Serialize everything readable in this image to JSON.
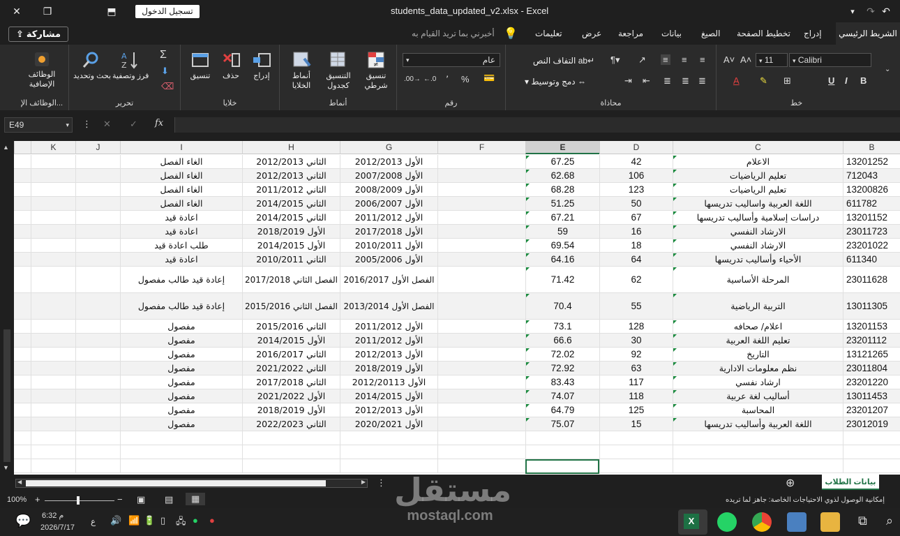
{
  "window": {
    "title": "students_data_updated_v2.xlsx  -  Excel",
    "signin_label": "تسجيل الدخول"
  },
  "tabs": {
    "share": "مشاركة",
    "tell_me": "أخبرني بما تريد القيام به",
    "items": [
      "الشريط الرئيسي",
      "إدراج",
      "تخطيط الصفحة",
      "الصيغ",
      "بيانات",
      "مراجعة",
      "عرض",
      "تعليمات"
    ]
  },
  "ribbon": {
    "addins": {
      "label": "الوظائف الإضافية",
      "group": "الوظائف الإ..."
    },
    "editing": {
      "find": "بحث وتحديد",
      "sort": "فرز وتصفية",
      "group": "تحرير"
    },
    "cells": {
      "format": "تنسيق",
      "delete": "حذف",
      "insert": "إدراج",
      "group": "خلايا"
    },
    "styles": {
      "cell_styles": "أنماط الخلايا",
      "format_table": "التنسيق كجدول",
      "conditional": "تنسيق شرطي",
      "group": "أنماط"
    },
    "number": {
      "format_value": "عام",
      "percent": "%",
      "comma": "٬",
      "group": "رقم"
    },
    "alignment": {
      "wrap": "التفاف النص",
      "merge": "دمج وتوسيط",
      "group": "محاذاة"
    },
    "font": {
      "name": "Calibri",
      "size": "11",
      "group": "خط"
    }
  },
  "formula_bar": {
    "name_box": "E49",
    "fx": "fx",
    "value": ""
  },
  "columns": [
    {
      "name": "K"
    },
    {
      "name": "J"
    },
    {
      "name": "I"
    },
    {
      "name": "H"
    },
    {
      "name": "G"
    },
    {
      "name": "F"
    },
    {
      "name": "E",
      "selected": true
    },
    {
      "name": "D"
    },
    {
      "name": "C"
    },
    {
      "name": "B"
    }
  ],
  "rows": [
    {
      "B": "13201252",
      "C": "الاعلام",
      "D": "42",
      "E": "67.25",
      "G": "الأول 2012/2013",
      "H": "الثاني 2012/2013",
      "I": "الغاء الفصل"
    },
    {
      "B": "712043",
      "C": "تعليم الرياضيات",
      "D": "106",
      "E": "62.68",
      "G": "الأول 2007/2008",
      "H": "الثاني 2012/2013",
      "I": "الغاء الفصل"
    },
    {
      "B": "13200826",
      "C": "تعليم الرياضيات",
      "D": "123",
      "E": "68.28",
      "G": "الأول 2008/2009",
      "H": "الثاني 2011/2012",
      "I": "الغاء الفصل"
    },
    {
      "B": "611782",
      "C": "اللغة العربية واساليب تدريسها",
      "D": "50",
      "E": "51.25",
      "G": "الأول 2006/2007",
      "H": "الثاني 2014/2015",
      "I": "الغاء الفصل"
    },
    {
      "B": "13201152",
      "C": "دراسات إسلامية وأساليب تدريسها",
      "D": "67",
      "E": "67.21",
      "G": "الأول 2011/2012",
      "H": "الثاني 2014/2015",
      "I": "اعادة قيد"
    },
    {
      "B": "23011723",
      "C": "الارشاد النفسي",
      "D": "16",
      "E": "59",
      "G": "الأول 2017/2018",
      "H": "الأول 2018/2019",
      "I": "اعادة قيد"
    },
    {
      "B": "23201022",
      "C": "الارشاد النفسي",
      "D": "18",
      "E": "69.54",
      "G": "الأول 2010/2011",
      "H": "الأول 2014/2015",
      "I": "طلب اعادة قيد"
    },
    {
      "B": "611340",
      "C": "الأحياء وأساليب تدريسها",
      "D": "64",
      "E": "64.16",
      "G": "الأول 2005/2006",
      "H": "الثاني 2010/2011",
      "I": "اعادة قيد"
    },
    {
      "B": "23011628",
      "C": "المرحلة الأساسية",
      "D": "62",
      "E": "71.42",
      "G": "الفصل الأول 2016/2017",
      "H": "الفصل الثاني 2017/2018",
      "I": "إعادة قيد طالب مفصول",
      "tall": true
    },
    {
      "B": "13011305",
      "C": "التربية الرياضية",
      "D": "55",
      "E": "70.4",
      "G": "الفصل الأول 2013/2014",
      "H": "الفصل الثاني 2015/2016",
      "I": "إعادة قيد طالب مفصول",
      "tall": true
    },
    {
      "B": "13201153",
      "C": "اعلام/ صحافه",
      "D": "128",
      "E": "73.1",
      "G": "الأول 2011/2012",
      "H": "الثاني 2015/2016",
      "I": "مفصول"
    },
    {
      "B": "23201112",
      "C": "تعليم اللغة العربية",
      "D": "30",
      "E": "66.6",
      "G": "الأول 2011/2012",
      "H": "الأول 2014/2015",
      "I": "مفصول"
    },
    {
      "B": "13121265",
      "C": "التاريخ",
      "D": "92",
      "E": "72.02",
      "G": "الأول 2012/2013",
      "H": "الثاني 2016/2017",
      "I": "مفصول"
    },
    {
      "B": "23011804",
      "C": "نظم معلومات الادارية",
      "D": "63",
      "E": "72.92",
      "G": "الأول 2018/2019",
      "H": "الثاني 2021/2022",
      "I": "مفصول"
    },
    {
      "B": "23201220",
      "C": "ارشاد نفسي",
      "D": "117",
      "E": "83.43",
      "G": "الأول 2012/20113",
      "H": "الثاني 2017/2018",
      "I": "مفصول"
    },
    {
      "B": "13011453",
      "C": "أساليب لغة عربية",
      "D": "118",
      "E": "74.07",
      "G": "الأول 2014/2015",
      "H": "الأول 2021/2022",
      "I": "مفصول"
    },
    {
      "B": "23201207",
      "C": "المحاسبة",
      "D": "125",
      "E": "64.79",
      "G": "الأول 2012/2013",
      "H": "الأول 2018/2019",
      "I": "مفصول"
    },
    {
      "B": "23012019",
      "C": "اللغة العربية وأساليب تدريسها",
      "D": "15",
      "E": "75.07",
      "G": "الأول 2020/2021",
      "H": "الثاني 2022/2023",
      "I": "مفصول"
    }
  ],
  "sheet": {
    "tab": "بيانات الطلاب"
  },
  "status": {
    "zoom": "100%",
    "accessibility": "إمكانية الوصول لذوي الاحتياجات الخاصة: جاهز لما تريده"
  },
  "taskbar": {
    "time": "6:32 م",
    "date": "2026/7/17",
    "lang": "ع"
  },
  "watermark": {
    "text": "مستقل",
    "sub": "mostaql.com"
  }
}
